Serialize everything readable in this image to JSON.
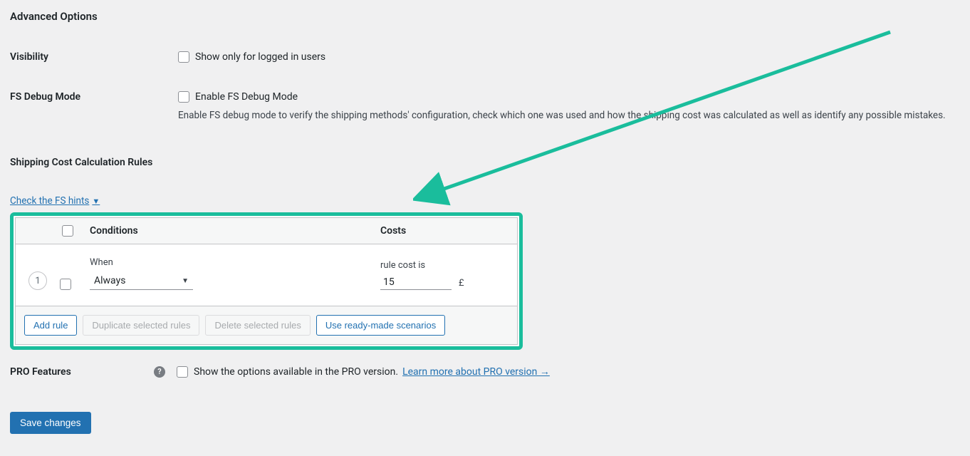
{
  "title": "Advanced Options",
  "rows": {
    "visibility": {
      "label": "Visibility",
      "checkbox_label": "Show only for logged in users"
    },
    "debug": {
      "label": "FS Debug Mode",
      "checkbox_label": "Enable FS Debug Mode",
      "help": "Enable FS debug mode to verify the shipping methods' configuration, check which one was used and how the shipping cost was calculated as well as identify any possible mistakes."
    },
    "rules": {
      "label": "Shipping Cost Calculation Rules"
    },
    "pro": {
      "label": "PRO Features",
      "checkbox_label": "Show the options available in the PRO version.",
      "link": "Learn more about PRO version →"
    }
  },
  "hints_link": "Check the FS hints",
  "hints_arrow": "▼",
  "table": {
    "header_conditions": "Conditions",
    "header_costs": "Costs",
    "row": {
      "index": "1",
      "when_label": "When",
      "when_value": "Always",
      "cost_label": "rule cost is",
      "cost_value": "15",
      "currency": "£"
    },
    "buttons": {
      "add": "Add rule",
      "duplicate": "Duplicate selected rules",
      "delete": "Delete selected rules",
      "scenarios": "Use ready-made scenarios"
    }
  },
  "save": "Save changes"
}
